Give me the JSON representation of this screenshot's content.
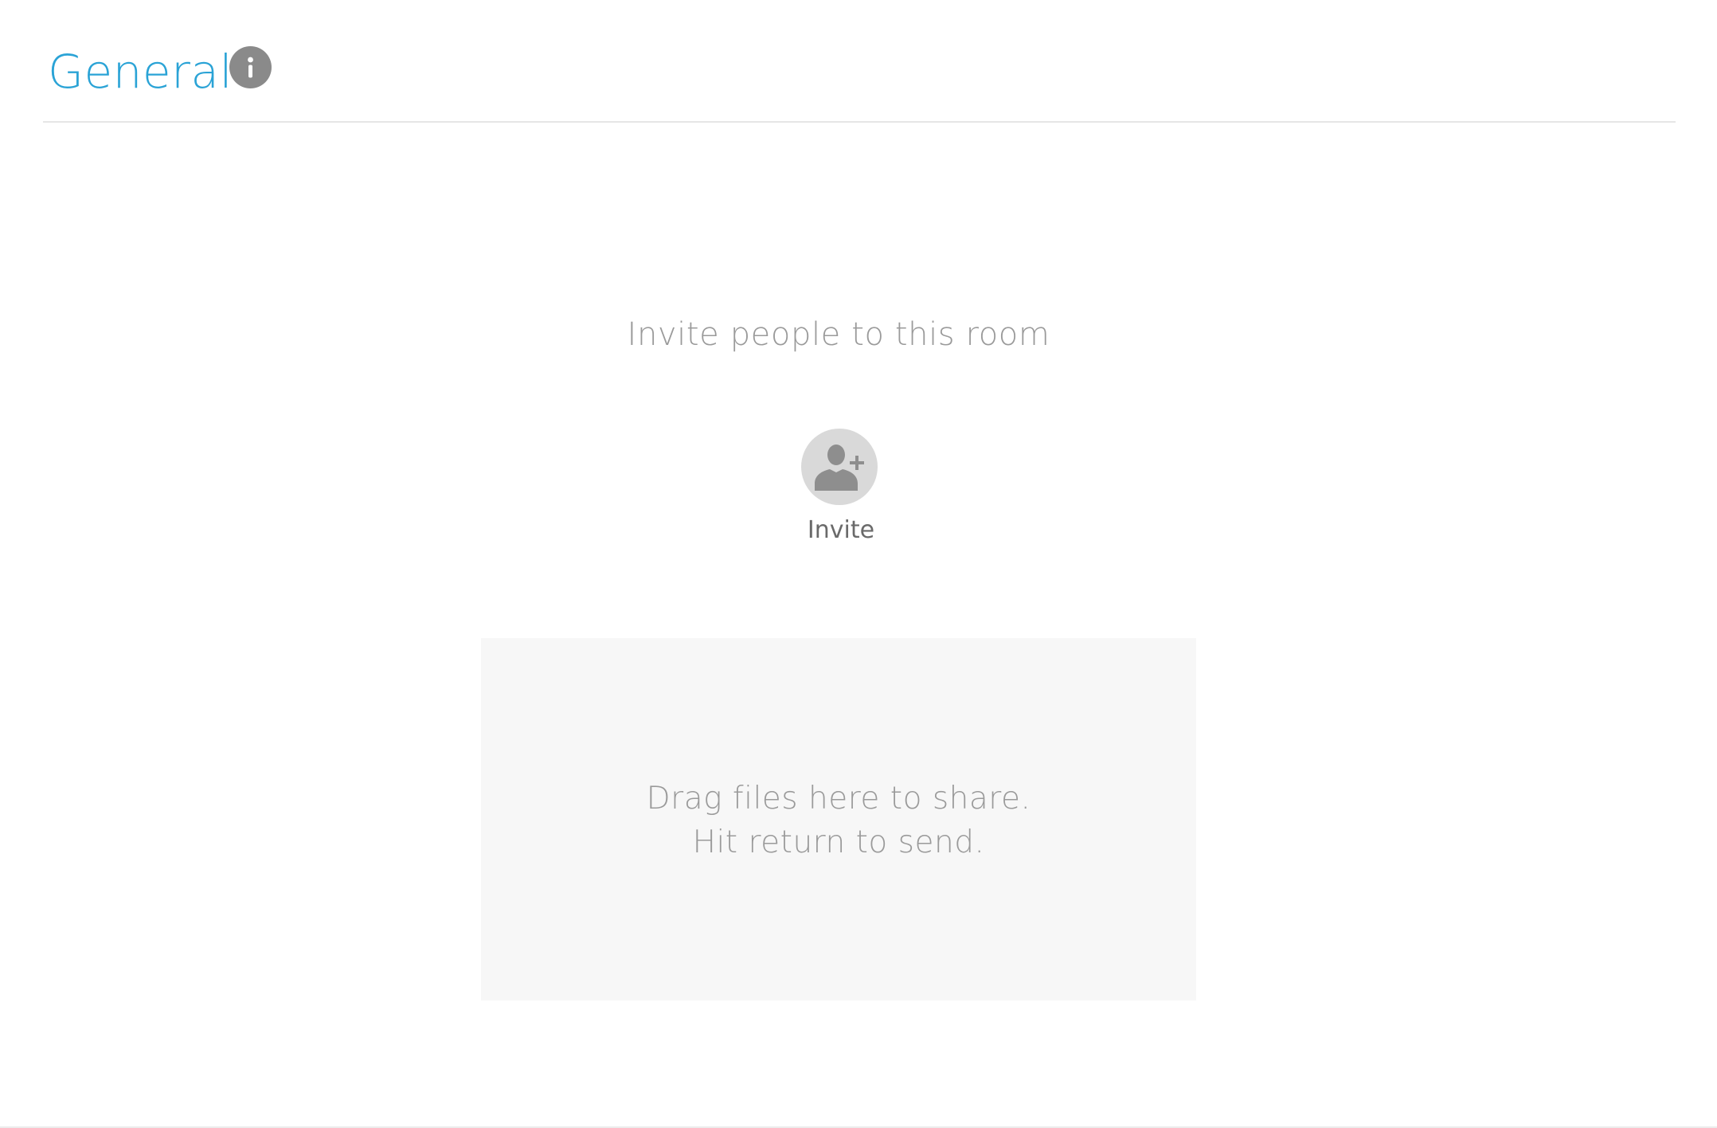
{
  "header": {
    "title": "General",
    "info_icon": "info-icon",
    "title_color": "#2aa3d6"
  },
  "invite": {
    "heading": "Invite people to this room",
    "button_icon": "add-person-icon",
    "button_label": "Invite"
  },
  "drop_zone": {
    "line1": "Drag files here to share.",
    "line2": "Hit return to send."
  }
}
